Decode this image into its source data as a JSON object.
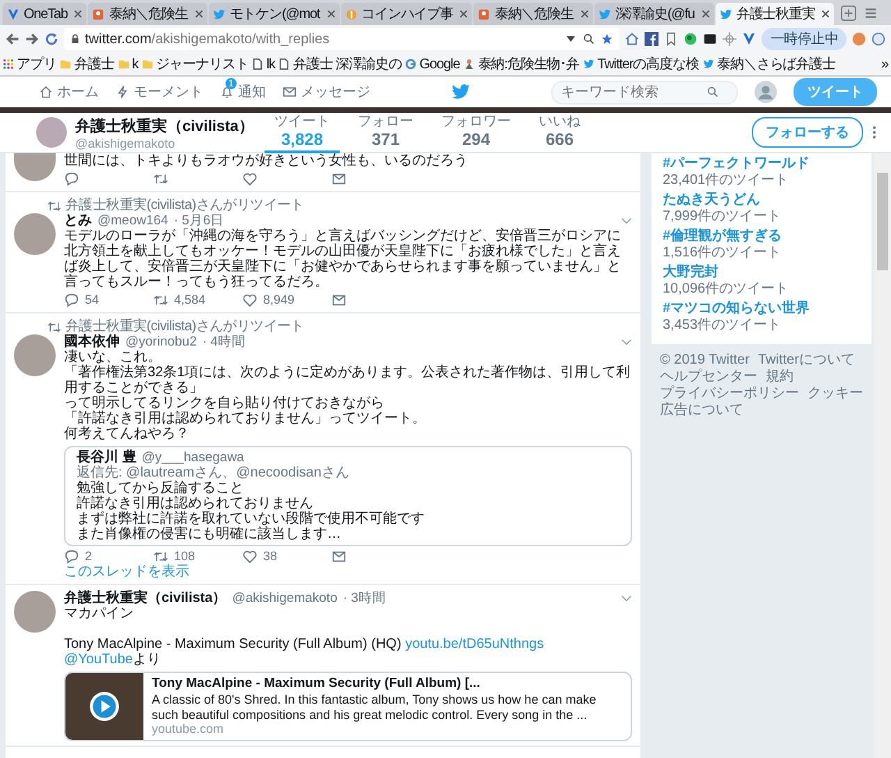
{
  "browser": {
    "tabs": [
      {
        "title": "OneTab",
        "kind": "onetab",
        "selected": false
      },
      {
        "title": "泰納＼危険生",
        "kind": "blog",
        "selected": false
      },
      {
        "title": "モトケン(@mot",
        "kind": "twitter",
        "selected": false
      },
      {
        "title": "コインハイブ事",
        "kind": "coin",
        "selected": false
      },
      {
        "title": "泰納＼危険生",
        "kind": "blog",
        "selected": false
      },
      {
        "title": "深澤諭史(@fu",
        "kind": "twitter",
        "selected": false
      },
      {
        "title": "弁護士秋重実",
        "kind": "twitter",
        "selected": true
      }
    ],
    "address": {
      "host": "twitter.com",
      "path": "/akishigemakoto/with_replies"
    },
    "pause_button": "一時停止中",
    "bookmarks": [
      {
        "label": "アプリ",
        "kind": "apps"
      },
      {
        "label": "弁護士",
        "kind": "folder"
      },
      {
        "label": "k",
        "kind": "folder"
      },
      {
        "label": "ジャーナリスト",
        "kind": "folder"
      },
      {
        "label": "lk",
        "kind": "page"
      },
      {
        "label": "弁護士 深澤諭史の",
        "kind": "page"
      },
      {
        "label": "Google",
        "kind": "google"
      },
      {
        "label": "泰納:危険生物･弁",
        "kind": "blog"
      },
      {
        "label": "Twitterの高度な検",
        "kind": "twitter"
      },
      {
        "label": "泰納＼さらば弁護士",
        "kind": "twitter"
      }
    ],
    "bookmarks_more": "»"
  },
  "nav": {
    "items": [
      {
        "label": "ホーム",
        "kind": "home"
      },
      {
        "label": "モーメント",
        "kind": "moments"
      },
      {
        "label": "通知",
        "kind": "notifications",
        "badge": "1"
      },
      {
        "label": "メッセージ",
        "kind": "messages"
      }
    ],
    "search": {
      "placeholder": "キーワード検索"
    },
    "tweet_button": "ツイート"
  },
  "profile": {
    "name": "弁護士秋重実（civilista）",
    "handle": "@akishigemakoto",
    "stats": [
      {
        "label": "ツイート",
        "value": "3,828",
        "selected": true
      },
      {
        "label": "フォロー",
        "value": "371",
        "selected": false
      },
      {
        "label": "フォロワー",
        "value": "294",
        "selected": false
      },
      {
        "label": "いいね",
        "value": "666",
        "selected": false
      }
    ],
    "follow_button": "フォローする"
  },
  "timeline": [
    {
      "paragraphs": [
        {
          "lines": [
            {
              "segments": [
                {
                  "kind": "text",
                  "text": "世間には、トキよりもラオウが好きという女性も、いるのだろう"
                }
              ]
            }
          ]
        }
      ],
      "actions": [
        {
          "kind": "reply"
        },
        {
          "kind": "retweet"
        },
        {
          "kind": "like"
        },
        {
          "kind": "dm"
        }
      ]
    },
    {
      "retweeted_by": "弁護士秋重実(civilista)さんがリツイート",
      "name": "とみ",
      "handle": "@meow164",
      "time": "· 5月6日",
      "paragraphs": [
        {
          "lines": [
            {
              "segments": [
                {
                  "kind": "text",
                  "text": "モデルのローラが「沖縄の海を守ろう」と言えばバッシングだけど、安倍晋三がロシアに北方領土を献上してもオッケー！モデルの山田優が天皇陛下に「お疲れ様でした」と言えば炎上して、安倍晋三が天皇陛下に「お健やかであらせられます事を願っていません」と言ってもスルー！ってもう狂ってるだろ。"
                }
              ]
            }
          ]
        }
      ],
      "actions": [
        {
          "kind": "reply",
          "count": "54"
        },
        {
          "kind": "retweet",
          "count": "4,584"
        },
        {
          "kind": "like",
          "count": "8,949"
        },
        {
          "kind": "dm"
        }
      ]
    },
    {
      "retweeted_by": "弁護士秋重実(civilista)さんがリツイート",
      "name": "國本依伸",
      "handle": "@yorinobu2",
      "time": "· 4時間",
      "paragraphs": [
        {
          "lines": [
            {
              "segments": [
                {
                  "kind": "text",
                  "text": "凄いな、これ。"
                }
              ]
            },
            {
              "segments": [
                {
                  "kind": "text",
                  "text": "「著作権法第32条1項には、次のように定めがあります。公表された著作物は、引用して利用することができる」"
                }
              ]
            },
            {
              "segments": [
                {
                  "kind": "text",
                  "text": "って明示してるリンクを自ら貼り付けておきながら"
                }
              ]
            },
            {
              "segments": [
                {
                  "kind": "text",
                  "text": "「許諾なき引用は認められておりません」ってツイート。"
                }
              ]
            },
            {
              "segments": [
                {
                  "kind": "text",
                  "text": "何考えてんねやろ？"
                }
              ]
            }
          ]
        }
      ],
      "quote": {
        "name": "長谷川 豊",
        "handle": "@y___hasegawa",
        "reply_to": "返信先: @lautreamさん、@necoodisanさん",
        "lines": [
          "勉強してから反論すること",
          "許諾なき引用は認められておりません",
          "まずは弊社に許諾を取れていない段階で使用不可能です",
          "また肖像権の侵害にも明確に該当します…"
        ]
      },
      "actions": [
        {
          "kind": "reply",
          "count": "2"
        },
        {
          "kind": "retweet",
          "count": "108"
        },
        {
          "kind": "like",
          "count": "38"
        },
        {
          "kind": "dm"
        }
      ],
      "thread_link": "このスレッドを表示"
    },
    {
      "name": "弁護士秋重実（civilista）",
      "handle": "@akishigemakoto",
      "time": "· 3時間",
      "paragraphs": [
        {
          "lines": [
            {
              "segments": [
                {
                  "kind": "text",
                  "text": "マカパイン"
                }
              ]
            }
          ]
        },
        {
          "lines": [
            {
              "segments": [
                {
                  "kind": "text",
                  "text": "Tony MacAlpine - Maximum Security (Full Album) (HQ) "
                },
                {
                  "kind": "link",
                  "text": "youtu.be/tD65uNthngs"
                }
              ]
            },
            {
              "segments": [
                {
                  "kind": "link",
                  "text": "@YouTube"
                },
                {
                  "kind": "text",
                  "text": "より"
                }
              ]
            }
          ]
        }
      ],
      "card": {
        "title": "Tony MacAlpine - Maximum Security (Full Album) [...",
        "description": "A classic of 80's Shred. In this fantastic album, Tony shows us how he can make such beautiful compositions and his great melodic control. Every song in the ...",
        "domain": "youtube.com"
      }
    }
  ],
  "trends": [
    {
      "name": "#パーフェクトワールド",
      "count": "23,401件のツイート"
    },
    {
      "name": "たぬき天うどん",
      "count": "7,999件のツイート"
    },
    {
      "name": "#倫理観が無すぎる",
      "count": "1,516件のツイート"
    },
    {
      "name": "大野完封",
      "count": "10,096件のツイート"
    },
    {
      "name": "#マツコの知らない世界",
      "count": "3,453件のツイート"
    }
  ],
  "footer": [
    "© 2019 Twitter",
    "Twitterについて",
    "ヘルプセンター",
    "規約",
    "プライバシーポリシー",
    "クッキー",
    "広告について"
  ]
}
